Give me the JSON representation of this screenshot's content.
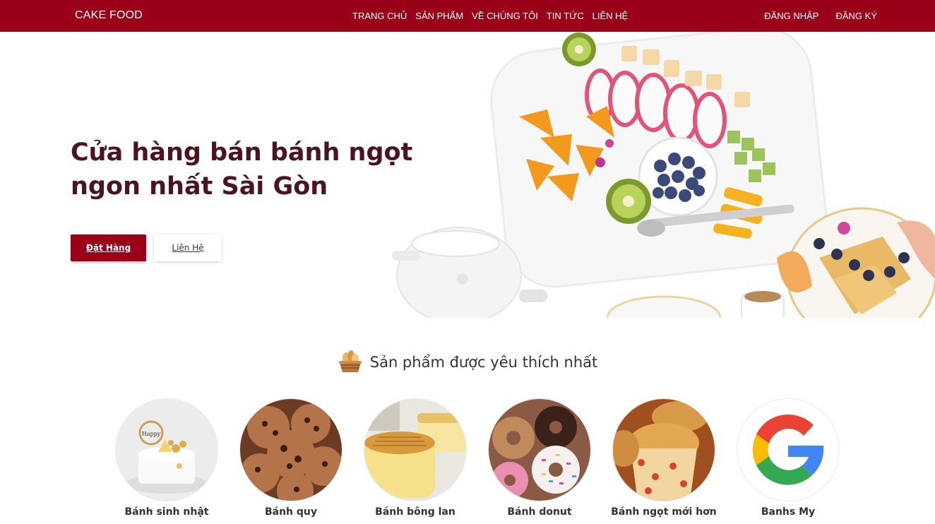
{
  "navbar": {
    "brand": "CAKE FOOD",
    "links": [
      "TRANG CHỦ",
      "SẢN PHẨM",
      "VỀ CHÚNG TÔI",
      "TIN TỨC",
      "LIÊN HỆ"
    ],
    "login": "ĐĂNG NHẬP",
    "register": "ĐĂNG KÝ",
    "color": "#9a0017"
  },
  "hero": {
    "title_line1": "Cửa hàng bán bánh ngọt",
    "title_line2": "ngon nhất Sài Gòn",
    "order_button": "Đặt Hàng",
    "contact_button": "Liên Hệ",
    "image": "fruit-platter-teapot-pancakes"
  },
  "section": {
    "title": "Sản phẩm được yêu thích nhất",
    "icon": "bread-basket-icon"
  },
  "products": [
    {
      "name": "Bánh sinh nhật",
      "image": "birthday-cake"
    },
    {
      "name": "Bánh quy",
      "image": "chocolate-chip-cookies"
    },
    {
      "name": "Bánh bông lan",
      "image": "sponge-cake"
    },
    {
      "name": "Bánh donut",
      "image": "donuts"
    },
    {
      "name": "Bánh ngọt mới hơn",
      "image": "muffins"
    },
    {
      "name": "Banhs My",
      "image": "google-logo"
    }
  ]
}
